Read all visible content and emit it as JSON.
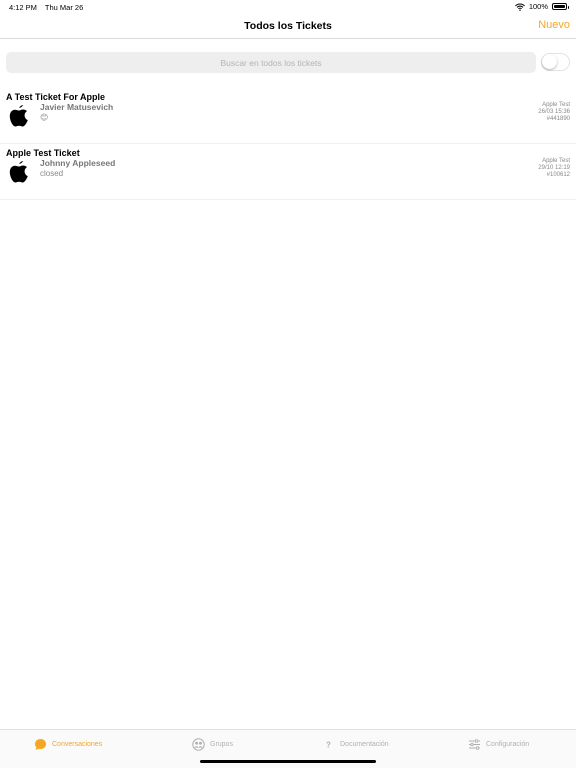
{
  "status_bar": {
    "time": "4:12 PM",
    "date": "Thu Mar 26",
    "battery": "100%",
    "battery_level": 1.0
  },
  "nav": {
    "title": "Todos los Tickets",
    "new_button": "Nuevo"
  },
  "search": {
    "placeholder": "Buscar en todos los tickets",
    "value": "",
    "toggle_on": false
  },
  "tickets": [
    {
      "title": "A Test Ticket For Apple",
      "name": "Javier Matusevich",
      "status": "😊",
      "company": "Apple Test",
      "date": "26/03 15:36",
      "id": "#441890"
    },
    {
      "title": "Apple Test Ticket",
      "name": "Johnny Appleseed",
      "status": "closed",
      "company": "Apple Test",
      "date": "29/10 12:19",
      "id": "#100612"
    }
  ],
  "tabs": [
    {
      "label": "Conversaciones",
      "icon": "chat-bubble-icon",
      "active": true
    },
    {
      "label": "Grupos",
      "icon": "group-icon",
      "active": false
    },
    {
      "label": "Documentación",
      "icon": "question-icon",
      "active": false
    },
    {
      "label": "Configuración",
      "icon": "sliders-icon",
      "active": false
    }
  ],
  "colors": {
    "accent": "#f5a623",
    "inactive": "#b0b0b0",
    "search_bg": "#eeeeef"
  }
}
